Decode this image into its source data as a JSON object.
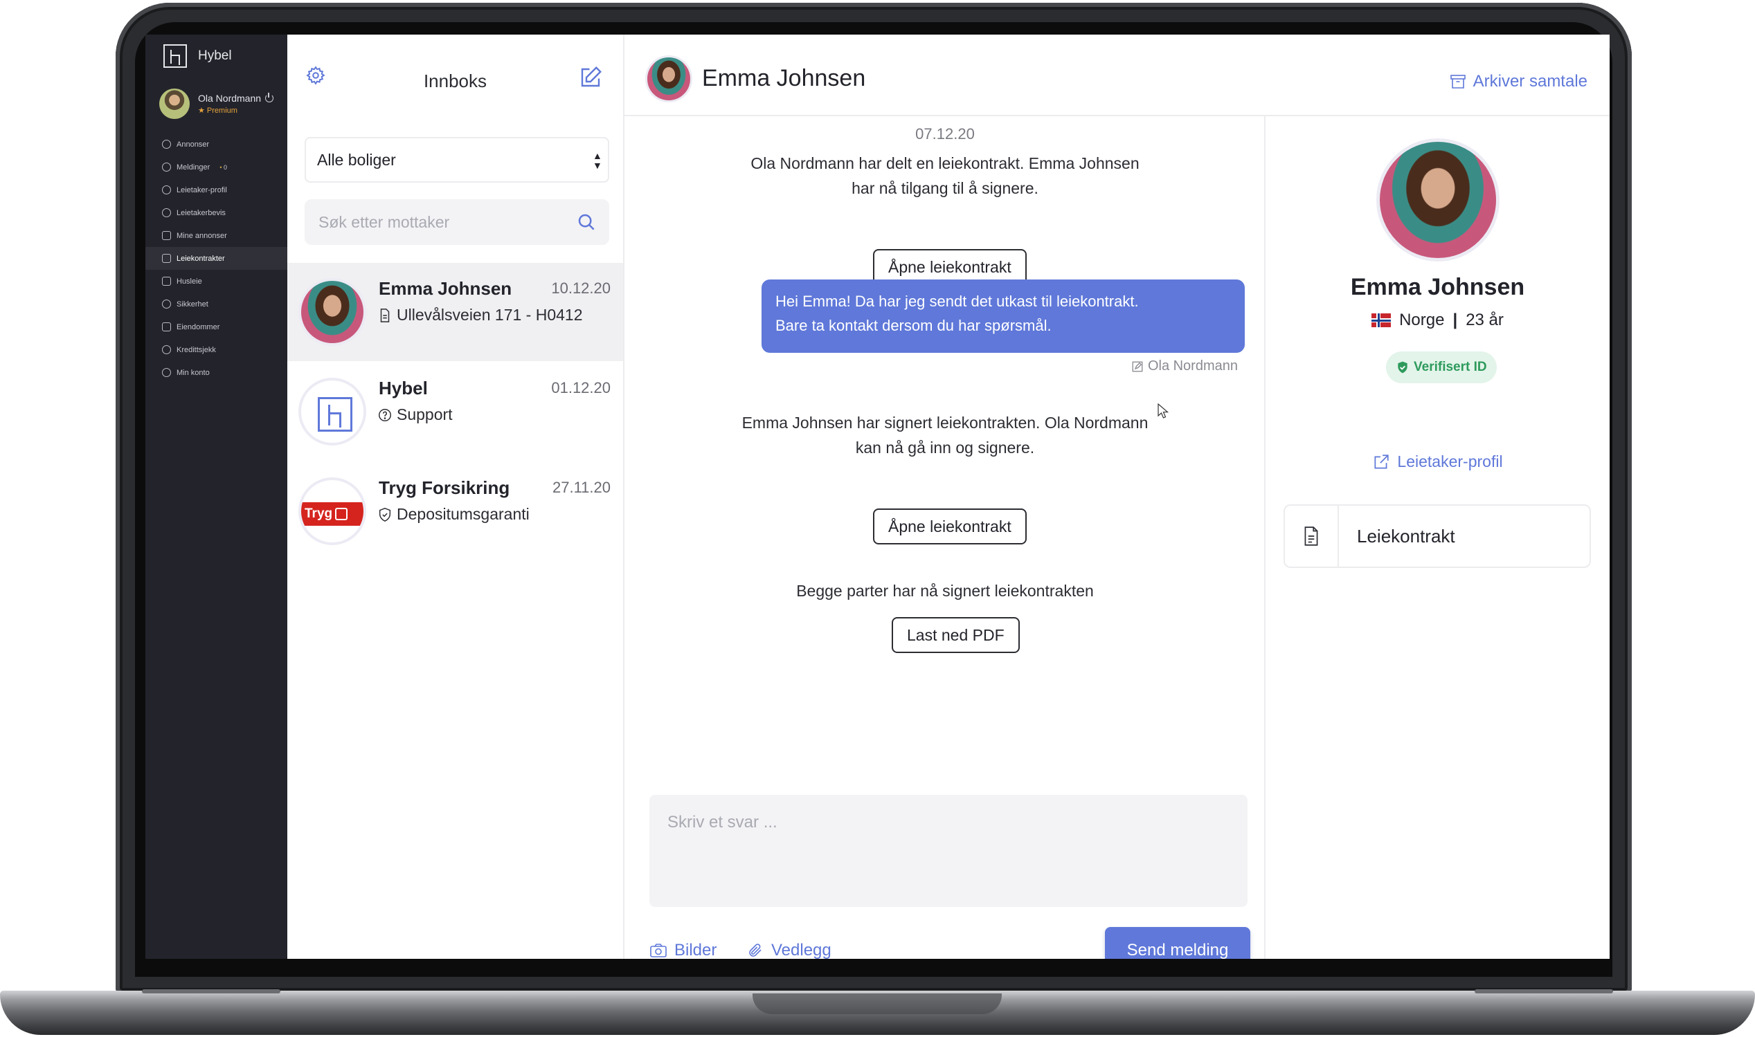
{
  "app": {
    "name": "Hybel"
  },
  "colors": {
    "accent": "#5f78d9",
    "sidebar_bg": "#23242b",
    "verified": "#2e9a5c",
    "premium": "#e5a23c",
    "tryg_red": "#d5241e"
  },
  "user": {
    "name": "Ola Nordmann",
    "tier": "Premium"
  },
  "sidebar": {
    "items": [
      {
        "label": "Annonser",
        "icon": "search-icon"
      },
      {
        "label": "Meldinger",
        "icon": "chat-icon",
        "badge": "0"
      },
      {
        "label": "Leietaker-profil",
        "icon": "user-icon"
      },
      {
        "label": "Leietakerbevis",
        "icon": "badge-icon"
      },
      {
        "label": "Mine annonser",
        "icon": "list-icon"
      },
      {
        "label": "Leiekontrakter",
        "icon": "document-icon",
        "active": true
      },
      {
        "label": "Husleie",
        "icon": "money-icon"
      },
      {
        "label": "Sikkerhet",
        "icon": "shield-icon"
      },
      {
        "label": "Eiendommer",
        "icon": "building-icon"
      },
      {
        "label": "Kredittsjekk",
        "icon": "magnifier-icon"
      },
      {
        "label": "Min konto",
        "icon": "account-icon"
      }
    ]
  },
  "inbox": {
    "title": "Innboks",
    "filter": {
      "selected": "Alle boliger"
    },
    "search": {
      "placeholder": "Søk etter mottaker"
    },
    "conversations": [
      {
        "name": "Emma Johnsen",
        "date": "10.12.20",
        "subtitle": "Ullevålsveien 171 - H0412",
        "icon": "document-icon",
        "selected": true
      },
      {
        "name": "Hybel",
        "date": "01.12.20",
        "subtitle": "Support",
        "icon": "question-icon"
      },
      {
        "name": "Tryg Forsikring",
        "date": "27.11.20",
        "subtitle": "Depositumsgaranti",
        "icon": "shield-icon",
        "logo_text": "Tryg"
      }
    ]
  },
  "chat": {
    "contact_name": "Emma Johnsen",
    "archive_label": "Arkiver samtale",
    "date": "07.12.20",
    "events": {
      "shared_line1": "Ola Nordmann har delt en leiekontrakt. Emma Johnsen",
      "shared_line2": "har nå tilgang til å signere.",
      "open_contract_1": "Åpne leiekontrakt",
      "message_line1": "Hei Emma! Da har jeg sendt det utkast til leiekontrakt.",
      "message_line2": "Bare ta kontakt dersom du har spørsmål.",
      "message_sender": "Ola Nordmann",
      "signed_line1": "Emma Johnsen har signert leiekontrakten. Ola Nordmann",
      "signed_line2": "kan nå gå inn og signere.",
      "open_contract_2": "Åpne leiekontrakt",
      "both_signed": "Begge parter har nå signert leiekontrakten",
      "download_pdf": "Last ned PDF"
    },
    "reply": {
      "placeholder": "Skriv et svar ..."
    },
    "images_label": "Bilder",
    "attachment_label": "Vedlegg",
    "send_label": "Send melding"
  },
  "profile": {
    "name": "Emma Johnsen",
    "country": "Norge",
    "age": "23 år",
    "verified_label": "Verifisert ID",
    "profile_link": "Leietaker-profil",
    "document_label": "Leiekontrakt"
  }
}
